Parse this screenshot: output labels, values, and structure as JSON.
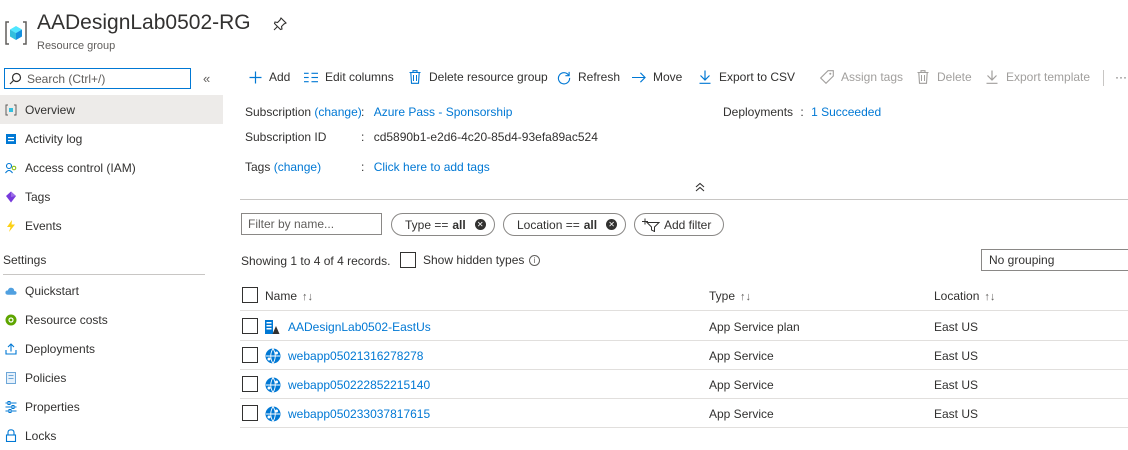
{
  "header": {
    "title": "AADesignLab0502-RG",
    "subtitle": "Resource group",
    "icon": "resource-group-icon",
    "pin_icon": "pin-icon"
  },
  "search": {
    "placeholder": "Search (Ctrl+/)",
    "value": ""
  },
  "sidebar": {
    "collapse_label": "«",
    "items": [
      {
        "label": "Overview",
        "icon": "overview-icon",
        "active": true
      },
      {
        "label": "Activity log",
        "icon": "activity-log-icon"
      },
      {
        "label": "Access control (IAM)",
        "icon": "iam-icon"
      },
      {
        "label": "Tags",
        "icon": "tag-icon"
      },
      {
        "label": "Events",
        "icon": "lightning-icon"
      }
    ],
    "settings_heading": "Settings",
    "settings_items": [
      {
        "label": "Quickstart",
        "icon": "cloud-icon"
      },
      {
        "label": "Resource costs",
        "icon": "cost-icon"
      },
      {
        "label": "Deployments",
        "icon": "deployment-icon"
      },
      {
        "label": "Policies",
        "icon": "policy-icon"
      },
      {
        "label": "Properties",
        "icon": "properties-icon"
      },
      {
        "label": "Locks",
        "icon": "lock-icon"
      }
    ]
  },
  "toolbar": {
    "add": "Add",
    "edit_columns": "Edit columns",
    "delete_rg": "Delete resource group",
    "refresh": "Refresh",
    "move": "Move",
    "export_csv": "Export to CSV",
    "assign_tags": "Assign tags",
    "delete": "Delete",
    "export_template": "Export template",
    "more": "···"
  },
  "essentials": {
    "subscription_label": "Subscription",
    "change_link": "(change)",
    "subscription_value": "Azure Pass - Sponsorship",
    "subscription_id_label": "Subscription ID",
    "subscription_id_value": "cd5890b1-e2d6-4c20-85d4-93efa89ac524",
    "tags_label": "Tags",
    "tags_change": "(change)",
    "tags_value": "Click here to add tags",
    "deployments_label": "Deployments",
    "deployments_value": "1 Succeeded",
    "separator": ":"
  },
  "filters": {
    "name_placeholder": "Filter by name...",
    "type_pill_prefix": "Type ==",
    "type_pill_value": "all",
    "location_pill_prefix": "Location ==",
    "location_pill_value": "all",
    "add_filter": "Add filter"
  },
  "records": {
    "showing": "Showing 1 to 4 of 4 records.",
    "show_hidden": "Show hidden types",
    "grouping": "No grouping"
  },
  "table": {
    "columns": [
      "Name",
      "Type",
      "Location"
    ],
    "sort_glyph": "↑↓",
    "rows": [
      {
        "name": "AADesignLab0502-EastUs",
        "type": "App Service plan",
        "location": "East US",
        "icon": "app-service-plan-icon"
      },
      {
        "name": "webapp05021316278278",
        "type": "App Service",
        "location": "East US",
        "icon": "app-service-icon"
      },
      {
        "name": "webapp050222852215140",
        "type": "App Service",
        "location": "East US",
        "icon": "app-service-icon"
      },
      {
        "name": "webapp050233037817615",
        "type": "App Service",
        "location": "East US",
        "icon": "app-service-icon"
      }
    ]
  },
  "colors": {
    "accent": "#0078d4",
    "active_bg": "#edebe9",
    "text": "#323130",
    "disabled": "#a19f9d"
  }
}
